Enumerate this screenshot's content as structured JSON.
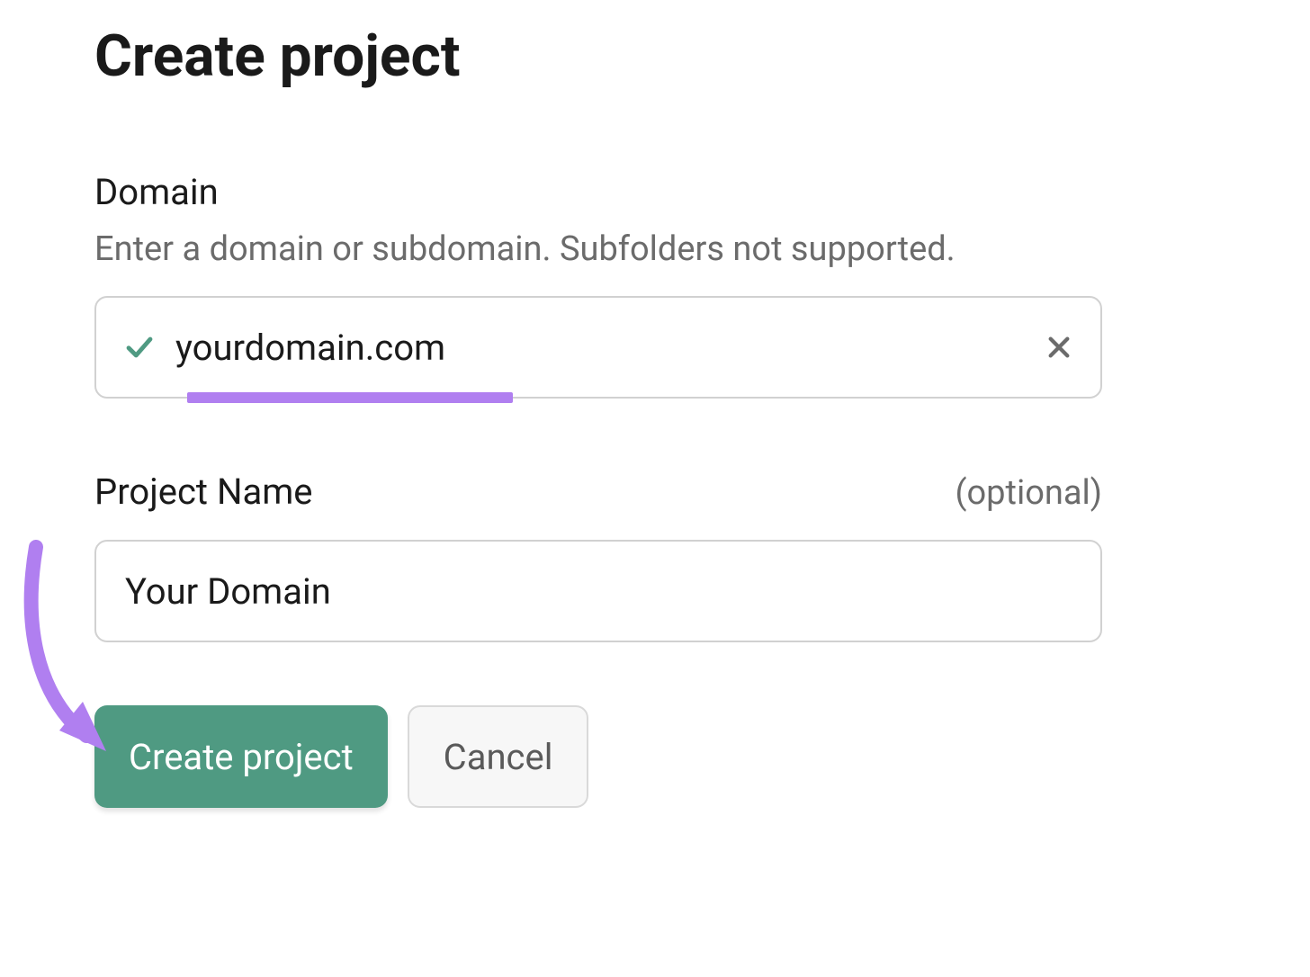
{
  "title": "Create project",
  "domain": {
    "label": "Domain",
    "helper": "Enter a domain or subdomain. Subfolders not supported.",
    "value": "yourdomain.com"
  },
  "projectName": {
    "label": "Project Name",
    "optional": "(optional)",
    "value": "Your Domain"
  },
  "buttons": {
    "create": "Create project",
    "cancel": "Cancel"
  },
  "colors": {
    "primary": "#4f9a82",
    "annotation": "#b07ff0"
  }
}
